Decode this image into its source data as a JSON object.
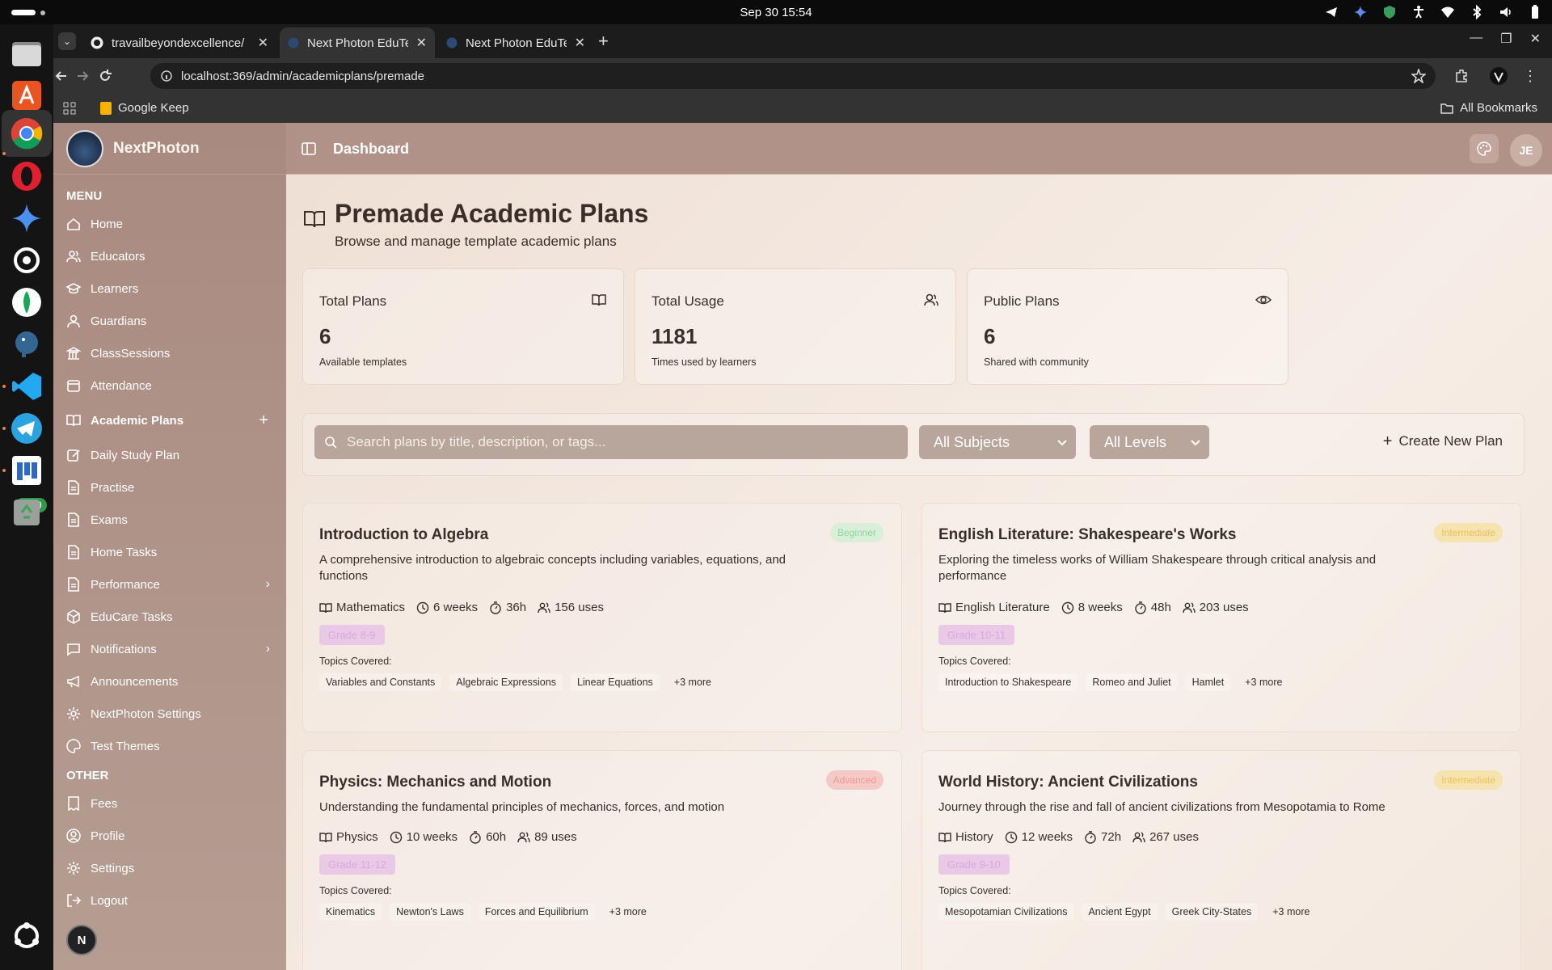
{
  "system": {
    "clock": "Sep 30  15:54"
  },
  "browser": {
    "tabs": [
      {
        "title": "travailbeyondexcellence/",
        "active": false
      },
      {
        "title": "Next Photon EduTech M",
        "active": true
      },
      {
        "title": "Next Photon EduTech M",
        "active": false
      }
    ],
    "url": "localhost:369/admin/academicplans/premade",
    "bookmarks": {
      "item": "Google Keep",
      "all": "All Bookmarks"
    }
  },
  "dock": {
    "badge": "9999"
  },
  "sidebar": {
    "brand": "NextPhoton",
    "menu_title": "MENU",
    "menu": [
      {
        "label": "Home",
        "icon": "home-icon"
      },
      {
        "label": "Educators",
        "icon": "users-icon"
      },
      {
        "label": "Learners",
        "icon": "graduation-cap-icon"
      },
      {
        "label": "Guardians",
        "icon": "user-icon"
      },
      {
        "label": "ClassSessions",
        "icon": "building-icon"
      },
      {
        "label": "Attendance",
        "icon": "calendar-icon"
      },
      {
        "label": "Academic Plans",
        "icon": "book-open-icon",
        "current": true,
        "action": "+"
      },
      {
        "label": "Daily Study Plan",
        "icon": "edit-icon"
      },
      {
        "label": "Practise",
        "icon": "file-text-icon"
      },
      {
        "label": "Exams",
        "icon": "file-text-icon"
      },
      {
        "label": "Home Tasks",
        "icon": "file-text-icon"
      },
      {
        "label": "Performance",
        "icon": "file-text-icon",
        "expandable": true
      },
      {
        "label": "EduCare Tasks",
        "icon": "package-icon"
      },
      {
        "label": "Notifications",
        "icon": "message-square-icon",
        "expandable": true
      },
      {
        "label": "Announcements",
        "icon": "megaphone-icon"
      },
      {
        "label": "NextPhoton Settings",
        "icon": "gear-icon"
      },
      {
        "label": "Test Themes",
        "icon": "palette-icon"
      }
    ],
    "other_title": "OTHER",
    "other": [
      {
        "label": "Fees",
        "icon": "receipt-icon"
      },
      {
        "label": "Profile",
        "icon": "user-circle-icon"
      },
      {
        "label": "Settings",
        "icon": "gear-icon"
      },
      {
        "label": "Logout",
        "icon": "logout-icon"
      }
    ],
    "footer_avatar": "N"
  },
  "header": {
    "title": "Dashboard",
    "user_initials": "JE"
  },
  "page": {
    "title": "Premade Academic Plans",
    "subtitle": "Browse and manage template academic plans"
  },
  "stats": [
    {
      "label": "Total Plans",
      "value": "6",
      "note": "Available templates",
      "icon": "book-open-icon"
    },
    {
      "label": "Total Usage",
      "value": "1181",
      "note": "Times used by learners",
      "icon": "users-icon"
    },
    {
      "label": "Public Plans",
      "value": "6",
      "note": "Shared with community",
      "icon": "eye-icon"
    }
  ],
  "filters": {
    "search_placeholder": "Search plans by title, description, or tags...",
    "subject": "All Subjects",
    "level": "All Levels",
    "create_label": "Create New Plan"
  },
  "plans": [
    {
      "title": "Introduction to Algebra",
      "level": "Beginner",
      "level_bg": "#d9efd9",
      "level_fg": "#8fd69a",
      "desc": "A comprehensive introduction to algebraic concepts including variables, equations, and functions",
      "subject": "Mathematics",
      "duration": "6 weeks",
      "hours": "36h",
      "uses": "156 uses",
      "grade": "Grade 8-9",
      "topics_label": "Topics Covered:",
      "topics": [
        "Variables and Constants",
        "Algebraic Expressions",
        "Linear Equations"
      ],
      "more": "+3 more"
    },
    {
      "title": "English Literature: Shakespeare's Works",
      "level": "Intermediate",
      "level_bg": "#f5e3b0",
      "level_fg": "#e9c25a",
      "desc": "Exploring the timeless works of William Shakespeare through critical analysis and performance",
      "subject": "English Literature",
      "duration": "8 weeks",
      "hours": "48h",
      "uses": "203 uses",
      "grade": "Grade 10-11",
      "topics_label": "Topics Covered:",
      "topics": [
        "Introduction to Shakespeare",
        "Romeo and Juliet",
        "Hamlet"
      ],
      "more": "+3 more"
    },
    {
      "title": "Physics: Mechanics and Motion",
      "level": "Advanced",
      "level_bg": "#f4c9c6",
      "level_fg": "#ee9a95",
      "desc": "Understanding the fundamental principles of mechanics, forces, and motion",
      "subject": "Physics",
      "duration": "10 weeks",
      "hours": "60h",
      "uses": "89 uses",
      "grade": "Grade 11-12",
      "topics_label": "Topics Covered:",
      "topics": [
        "Kinematics",
        "Newton's Laws",
        "Forces and Equilibrium"
      ],
      "more": "+3 more"
    },
    {
      "title": "World History: Ancient Civilizations",
      "level": "Intermediate",
      "level_bg": "#f5e3b0",
      "level_fg": "#e9c25a",
      "desc": "Journey through the rise and fall of ancient civilizations from Mesopotamia to Rome",
      "subject": "History",
      "duration": "12 weeks",
      "hours": "72h",
      "uses": "267 uses",
      "grade": "Grade 9-10",
      "topics_label": "Topics Covered:",
      "topics": [
        "Mesopotamian Civilizations",
        "Ancient Egypt",
        "Greek City-States"
      ],
      "more": "+3 more"
    }
  ]
}
